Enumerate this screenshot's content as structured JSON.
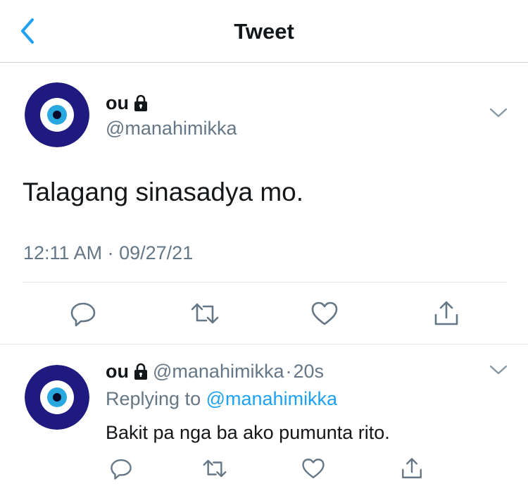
{
  "header": {
    "title": "Tweet"
  },
  "main_tweet": {
    "name": "ou",
    "handle": "@manahimikka",
    "text": "Talagang sinasadya mo.",
    "time": "12:11 AM",
    "dot": "·",
    "date": "09/27/21"
  },
  "reply_tweet": {
    "name": "ou",
    "handle": "@manahimikka",
    "dot": "·",
    "age": "20s",
    "replying_label": "Replying to",
    "replying_handle": "@manahimikka",
    "text": "Bakit pa nga ba ako pumunta rito."
  },
  "colors": {
    "accent": "#1da1f2",
    "secondary_text": "#657786",
    "avatar_navy": "#1e1a80",
    "avatar_blue": "#29a8e0"
  },
  "icons": [
    "back-chevron-icon",
    "lock-icon",
    "chevron-down-icon",
    "reply-icon",
    "retweet-icon",
    "like-icon",
    "share-icon"
  ]
}
